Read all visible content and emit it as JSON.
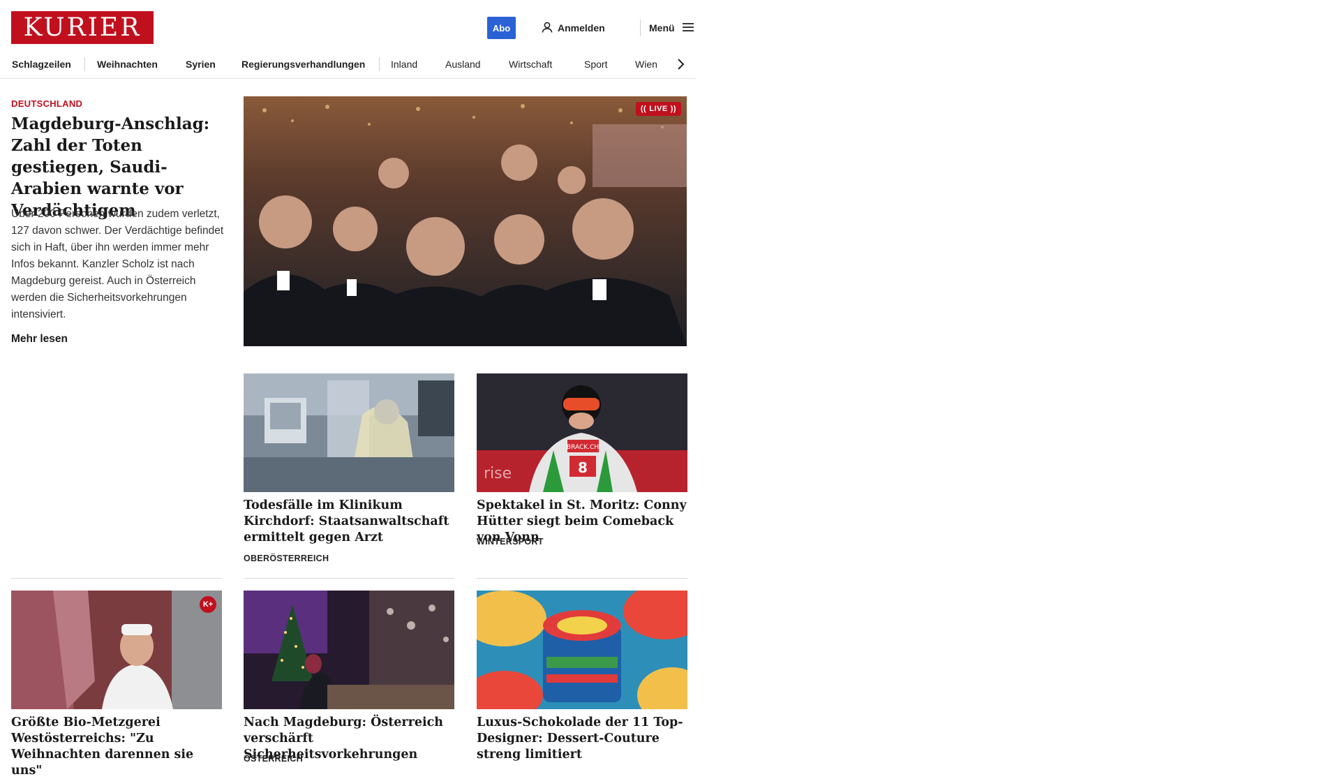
{
  "header": {
    "logo_text": "KURIER",
    "abo_label": "Abo",
    "login_label": "Anmelden",
    "menu_label": "Menü",
    "brand_color": "#c0101e",
    "accent_color": "#2a62d6"
  },
  "nav": {
    "items": [
      {
        "label": "Schlagzeilen"
      },
      {
        "label": "Weihnachten"
      },
      {
        "label": "Syrien"
      },
      {
        "label": "Regierungsverhandlungen"
      },
      {
        "label": "Inland"
      },
      {
        "label": "Ausland"
      },
      {
        "label": "Wirtschaft"
      },
      {
        "label": "Sport"
      },
      {
        "label": "Wien"
      }
    ],
    "next_icon": "chevron-right-icon"
  },
  "lead": {
    "kicker": "DEUTSCHLAND",
    "title": "Magdeburg-Anschlag: Zahl der Toten gestiegen, Saudi-Arabien warnte vor Verdächtigem",
    "text": "Über 200 Personen wurden zudem verletzt, 127 davon schwer. Der Verdächtige befindet sich in Haft, über ihn werden immer mehr Infos bekannt. Kanzler Scholz ist nach Magdeburg gereist. Auch in Österreich werden die Sicherheitsvorkehrungen intensiviert.",
    "more_label": "Mehr lesen",
    "live_label": "LIVE"
  },
  "cards": [
    {
      "title": "Todesfälle im Klinikum Kirchdorf: Staatsanwaltschaft ermittelt gegen Arzt",
      "section": "OBERÖSTERREICH"
    },
    {
      "title": "Spektakel in St. Moritz: Conny Hüt­ter siegt beim Comeback von Vonn",
      "section": "WINTERSPORT"
    },
    {
      "title": "Größte Bio-Metzgerei Westöster­reichs: \"Zu Weihnachten darennen sie uns\"",
      "section": "",
      "badge": "K+"
    },
    {
      "title": "Nach Magdeburg: Österreich ver­schärft Sicherheitsvorkehrungen",
      "section": "ÖSTERREICH"
    },
    {
      "title": "Luxus-Schokolade der 11 Top-Desi­gner: Dessert-Couture streng limitiert",
      "section": ""
    }
  ]
}
